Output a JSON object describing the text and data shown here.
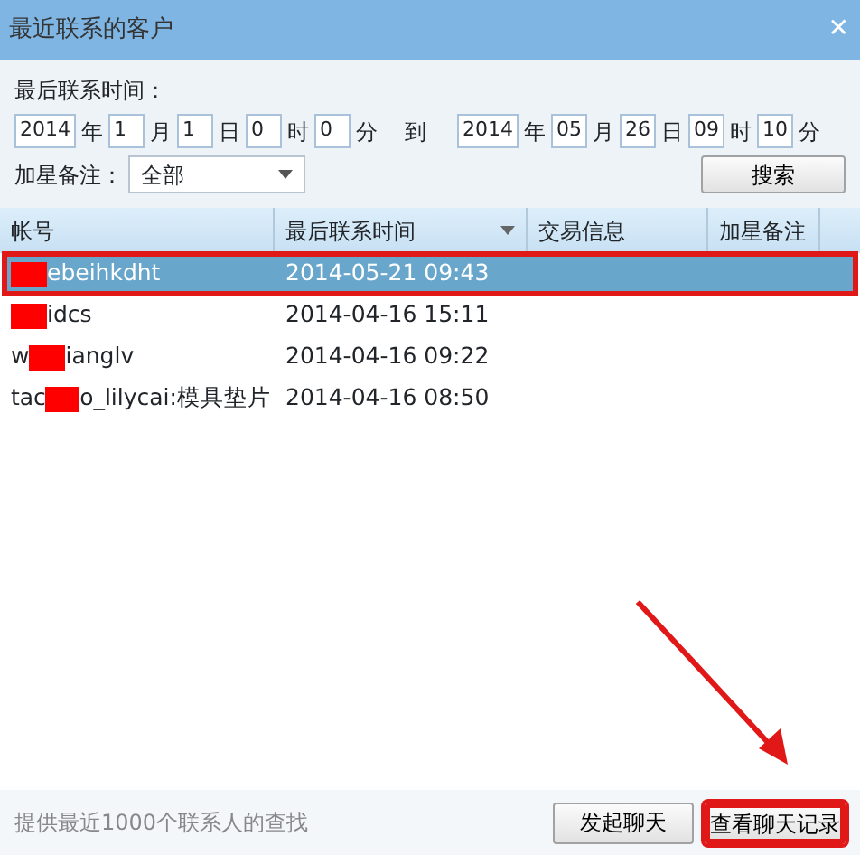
{
  "window": {
    "title": "最近联系的客户",
    "close": "✕"
  },
  "filter": {
    "label": "最后联系时间：",
    "from": [
      {
        "value": "2014",
        "unit": "年"
      },
      {
        "value": "1",
        "unit": "月"
      },
      {
        "value": "1",
        "unit": "日"
      },
      {
        "value": "0",
        "unit": "时"
      },
      {
        "value": "0",
        "unit": "分"
      }
    ],
    "to_label": "到",
    "to": [
      {
        "value": "2014",
        "unit": "年"
      },
      {
        "value": "05",
        "unit": "月"
      },
      {
        "value": "26",
        "unit": "日"
      },
      {
        "value": "09",
        "unit": "时"
      },
      {
        "value": "10",
        "unit": "分"
      }
    ],
    "star_label": "加星备注：",
    "star_value": "全部",
    "search_button": "搜索"
  },
  "table": {
    "columns": [
      {
        "label": "帐号",
        "sorted": false
      },
      {
        "label": "最后联系时间",
        "sorted": true
      },
      {
        "label": "交易信息",
        "sorted": false
      },
      {
        "label": "加星备注",
        "sorted": false
      }
    ],
    "rows": [
      {
        "account_parts": [
          "ebeihkdht"
        ],
        "time": "2014-05-21 09:43",
        "selected": true,
        "highlighted": true
      },
      {
        "account_parts": [
          "idcs"
        ],
        "time": "2014-04-16 15:11",
        "selected": false,
        "highlighted": false
      },
      {
        "account_parts": [
          "w",
          "ianglv"
        ],
        "time": "2014-04-16 09:22",
        "selected": false,
        "highlighted": false
      },
      {
        "account_parts": [
          "tac",
          "o_lilycai:模具垫片"
        ],
        "time": "2014-04-16 08:50",
        "selected": false,
        "highlighted": false
      }
    ]
  },
  "footer": {
    "hint": "提供最近1000个联系人的查找",
    "buttons": [
      {
        "label": "发起聊天",
        "highlighted": false
      },
      {
        "label": "查看聊天记录",
        "highlighted": true
      }
    ]
  },
  "pointer_arrow": true
}
